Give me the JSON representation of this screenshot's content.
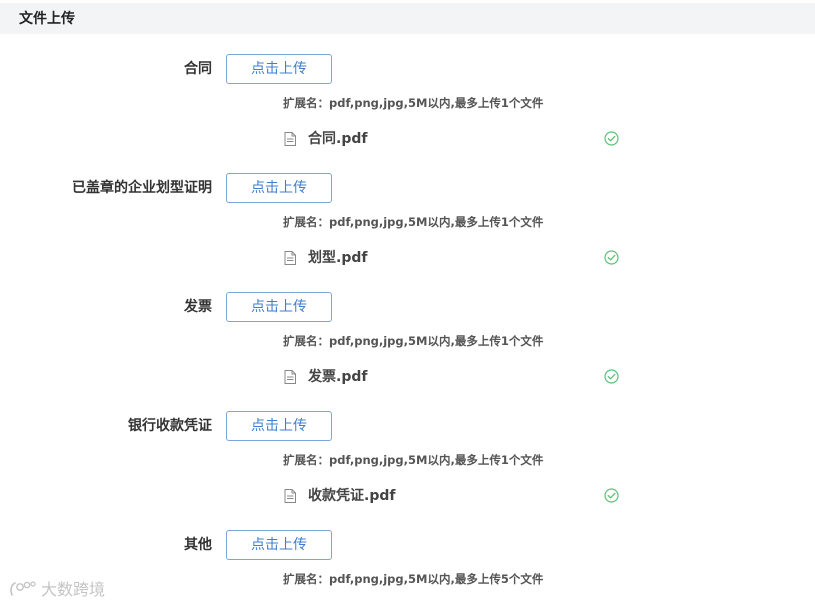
{
  "section": {
    "title": "文件上传"
  },
  "upload_button_label": "点击上传",
  "rows": [
    {
      "label": "合同",
      "hint": "扩展名：pdf,png,jpg,5M以内,最多上传1个文件",
      "file": "合同.pdf",
      "status": "success"
    },
    {
      "label": "已盖章的企业划型证明",
      "hint": "扩展名：pdf,png,jpg,5M以内,最多上传1个文件",
      "file": "划型.pdf",
      "status": "success"
    },
    {
      "label": "发票",
      "hint": "扩展名：pdf,png,jpg,5M以内,最多上传1个文件",
      "file": "发票.pdf",
      "status": "success"
    },
    {
      "label": "银行收款凭证",
      "hint": "扩展名：pdf,png,jpg,5M以内,最多上传1个文件",
      "file": "收款凭证.pdf",
      "status": "success"
    },
    {
      "label": "其他",
      "hint": "扩展名：pdf,png,jpg,5M以内,最多上传5个文件"
    }
  ],
  "watermark": {
    "text": "大数跨境"
  },
  "colors": {
    "header_bg": "#f3f4f6",
    "button_border": "#7aa7d9",
    "button_text": "#3f7fcf",
    "success": "#5cc27a"
  },
  "icons": {
    "file": "document-icon",
    "status": "check-circle-icon"
  }
}
